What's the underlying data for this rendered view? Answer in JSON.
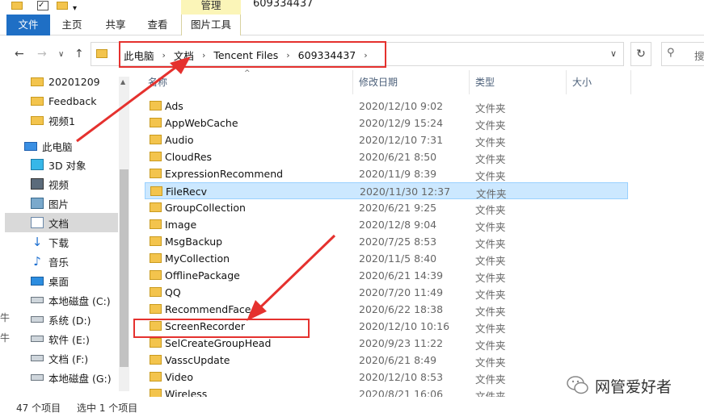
{
  "window": {
    "title": "609334437"
  },
  "ribbon": {
    "file_tab": "文件",
    "home_tab": "主页",
    "share_tab": "共享",
    "view_tab": "查看",
    "manage_label": "管理",
    "picture_tools_tab": "图片工具"
  },
  "nav": {
    "back_icon": "←",
    "forward_icon": "→",
    "recent_icon": "∨",
    "up_icon": "↑",
    "breadcrumbs": [
      "此电脑",
      "文档",
      "Tencent Files",
      "609334437"
    ],
    "breadcrumb_sep": "›",
    "address_dropdown": "∨",
    "refresh_icon": "↻",
    "search_icon": "⚲",
    "search_placeholder": "搜"
  },
  "sidebar": {
    "items": [
      {
        "label": "20201209",
        "icon": "folder-icon"
      },
      {
        "label": "Feedback",
        "icon": "folder-icon"
      },
      {
        "label": "视频1",
        "icon": "folder-icon"
      },
      {
        "label": "此电脑",
        "icon": "pc-icon"
      },
      {
        "label": "3D 对象",
        "icon": "3d-objects-icon"
      },
      {
        "label": "视频",
        "icon": "video-icon"
      },
      {
        "label": "图片",
        "icon": "picture-icon"
      },
      {
        "label": "文档",
        "icon": "document-icon"
      },
      {
        "label": "下载",
        "icon": "download-icon"
      },
      {
        "label": "音乐",
        "icon": "music-icon"
      },
      {
        "label": "桌面",
        "icon": "desktop-icon"
      },
      {
        "label": "本地磁盘 (C:)",
        "icon": "drive-icon"
      },
      {
        "label": "系统 (D:)",
        "icon": "drive-icon"
      },
      {
        "label": "软件 (E:)",
        "icon": "drive-icon"
      },
      {
        "label": "文档 (F:)",
        "icon": "drive-icon"
      },
      {
        "label": "本地磁盘 (G:)",
        "icon": "drive-icon"
      }
    ],
    "selected": "文档",
    "down_glyph": "↓",
    "note_glyph": "♪",
    "edge_char": "牛"
  },
  "columns": {
    "name": "名称",
    "date": "修改日期",
    "type": "类型",
    "size": "大小",
    "sort_glyph": "^"
  },
  "files": [
    {
      "name": "Ads",
      "date": "2020/12/10 9:02",
      "type": "文件夹"
    },
    {
      "name": "AppWebCache",
      "date": "2020/12/9 15:24",
      "type": "文件夹"
    },
    {
      "name": "Audio",
      "date": "2020/12/10 7:31",
      "type": "文件夹"
    },
    {
      "name": "CloudRes",
      "date": "2020/6/21 8:50",
      "type": "文件夹"
    },
    {
      "name": "ExpressionRecommend",
      "date": "2020/11/9 8:39",
      "type": "文件夹"
    },
    {
      "name": "FileRecv",
      "date": "2020/11/30 12:37",
      "type": "文件夹"
    },
    {
      "name": "GroupCollection",
      "date": "2020/6/21 9:25",
      "type": "文件夹"
    },
    {
      "name": "Image",
      "date": "2020/12/8 9:04",
      "type": "文件夹"
    },
    {
      "name": "MsgBackup",
      "date": "2020/7/25 8:53",
      "type": "文件夹"
    },
    {
      "name": "MyCollection",
      "date": "2020/11/5 8:40",
      "type": "文件夹"
    },
    {
      "name": "OfflinePackage",
      "date": "2020/6/21 14:39",
      "type": "文件夹"
    },
    {
      "name": "QQ",
      "date": "2020/7/20 11:49",
      "type": "文件夹"
    },
    {
      "name": "RecommendFace",
      "date": "2020/6/22 18:38",
      "type": "文件夹"
    },
    {
      "name": "ScreenRecorder",
      "date": "2020/12/10 10:16",
      "type": "文件夹"
    },
    {
      "name": "SelCreateGroupHead",
      "date": "2020/9/23 11:22",
      "type": "文件夹"
    },
    {
      "name": "VasscUpdate",
      "date": "2020/6/21 8:49",
      "type": "文件夹"
    },
    {
      "name": "Video",
      "date": "2020/12/10 8:53",
      "type": "文件夹"
    },
    {
      "name": "Wireless",
      "date": "2020/8/21 16:06",
      "type": "文件夹"
    }
  ],
  "selected_file": "FileRecv",
  "status": {
    "count": "47 个项目",
    "selection": "选中 1 个项目"
  },
  "watermark": "网管爱好者",
  "colors": {
    "accent": "#1f6fc5",
    "selection": "#cce8ff",
    "annotation": "#e5312e",
    "folder": "#f3c44d"
  }
}
